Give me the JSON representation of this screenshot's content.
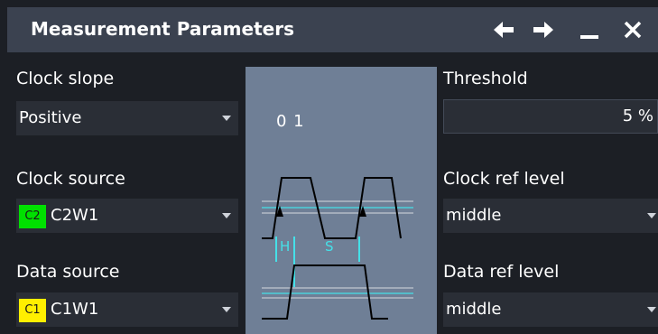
{
  "window": {
    "title": "Measurement Parameters",
    "controls": [
      "back-arrow-icon",
      "forward-arrow-icon",
      "minimize-icon",
      "close-icon"
    ]
  },
  "left": {
    "clock_slope": {
      "label": "Clock slope",
      "value": "Positive"
    },
    "clock_source": {
      "label": "Clock source",
      "badge": "C2",
      "badge_color": "#00e000",
      "value": "C2W1"
    },
    "data_source": {
      "label": "Data source",
      "badge": "C1",
      "badge_color": "#ffef00",
      "value": "C1W1"
    }
  },
  "diagram": {
    "bits": "0 1",
    "hold_label": "H",
    "setup_label": "S"
  },
  "right": {
    "threshold": {
      "label": "Threshold",
      "value": "5 %"
    },
    "clock_ref_level": {
      "label": "Clock ref level",
      "value": "middle"
    },
    "data_ref_level": {
      "label": "Data ref level",
      "value": "middle"
    }
  },
  "colors": {
    "titlebar": "#3b4250",
    "background": "#1c1f25",
    "field": "#2a2e36",
    "diagram_bg": "#6f7f96",
    "marker": "#45e0e8"
  }
}
